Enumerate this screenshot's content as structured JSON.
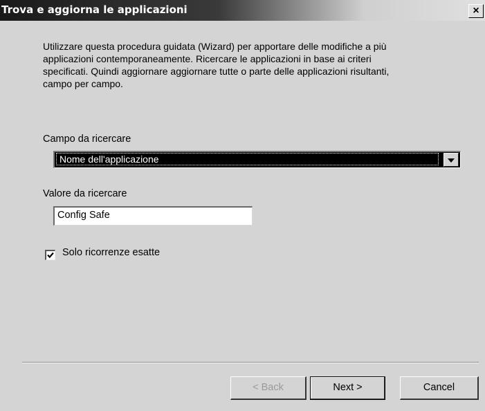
{
  "window": {
    "title": "Trova e aggiorna le applicazioni",
    "close_glyph": "×",
    "close_icon": "close-icon"
  },
  "intro": {
    "line1": "Utilizzare questa procedura guidata (Wizard) per apportare delle modifiche a più",
    "line2": "applicazioni contemporaneamente. Ricercare le applicazioni in base ai criteri",
    "line3": "specificati. Quindi aggiornare aggiornare tutte o parte delle applicazioni risultanti,",
    "line4": "campo per campo."
  },
  "search_field": {
    "label": "Campo da ricercare",
    "selected": "Nome dell'applicazione",
    "arrow_icon": "chevron-down-icon"
  },
  "search_value": {
    "label": "Valore da ricercare",
    "value": "Config Safe"
  },
  "exact_match": {
    "label": "Solo ricorrenze esatte",
    "checked": true
  },
  "buttons": {
    "back": "< Back",
    "next": "Next >",
    "cancel": "Cancel"
  }
}
